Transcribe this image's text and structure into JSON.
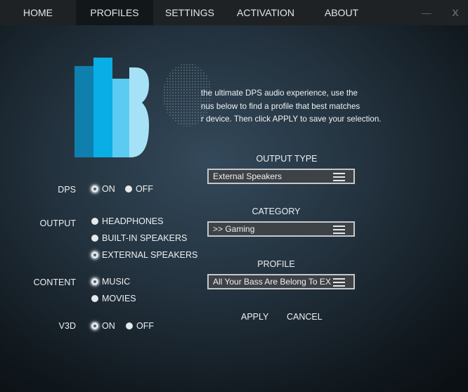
{
  "nav": {
    "tabs": [
      {
        "label": "HOME",
        "active": false
      },
      {
        "label": "PROFILES",
        "active": true
      },
      {
        "label": "SETTINGS",
        "active": false
      },
      {
        "label": "ACTIVATION",
        "active": false
      },
      {
        "label": "ABOUT",
        "active": false
      }
    ],
    "minimize": "—",
    "close": "X"
  },
  "intro": {
    "line1": "the ultimate DPS audio experience, use the",
    "line2": "nus below to find a profile that best matches",
    "line3": "r device. Then click APPLY to save your selection."
  },
  "dps": {
    "label": "DPS",
    "on": "ON",
    "off": "OFF",
    "selected": "on"
  },
  "output": {
    "label": "OUTPUT",
    "options": [
      "HEADPHONES",
      "BUILT-IN SPEAKERS",
      "EXTERNAL SPEAKERS"
    ],
    "selected": 2
  },
  "content": {
    "label": "CONTENT",
    "options": [
      "MUSIC",
      "MOVIES"
    ],
    "selected": 0
  },
  "v3d": {
    "label": "V3D",
    "on": "ON",
    "off": "OFF",
    "selected": "on"
  },
  "output_type": {
    "title": "OUTPUT TYPE",
    "value": "External Speakers"
  },
  "category": {
    "title": "CATEGORY",
    "value": ">> Gaming"
  },
  "profile": {
    "title": "PROFILE",
    "value": "All Your Bass Are Belong To EX"
  },
  "actions": {
    "apply": "APPLY",
    "cancel": "CANCEL"
  },
  "colors": {
    "logo_dark": "#0f7fae",
    "logo_mid": "#0aaee6",
    "logo_light": "#5ccbf2",
    "logo_lightest": "#a6e2f7"
  }
}
